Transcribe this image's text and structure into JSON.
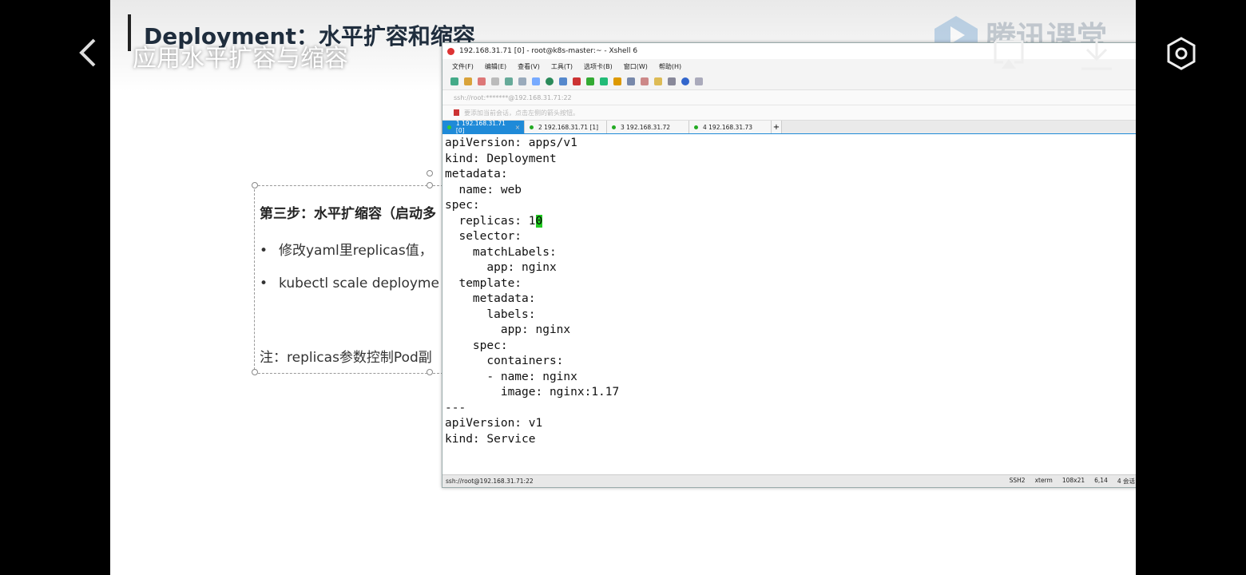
{
  "slide": {
    "title": "Deployment：水平扩容和缩容",
    "watermark": "腾讯课堂",
    "textbox": {
      "heading": "第三步：水平扩缩容（启动多",
      "bullets": [
        "•",
        "修改yaml里replicas值，",
        "kubectl scale deployme"
      ],
      "note": "注：replicas参数控制Pod副"
    }
  },
  "xshell": {
    "window_title": "192.168.31.71 [0] - root@k8s-master:~ - Xshell 6",
    "menu": [
      "文件(F)",
      "编辑(E)",
      "查看(V)",
      "工具(T)",
      "选项卡(B)",
      "窗口(W)",
      "帮助(H)"
    ],
    "address": "ssh://root:*******@192.168.31.71:22",
    "hint": "要添加当前会话，点击左侧的箭头按钮。",
    "tabs": [
      {
        "label": "1 192.168.31.71 [0]",
        "active": true
      },
      {
        "label": "2 192.168.31.71 [1]",
        "active": false
      },
      {
        "label": "3 192.168.31.72",
        "active": false
      },
      {
        "label": "4 192.168.31.73",
        "active": false
      }
    ],
    "tab_add": "+",
    "terminal_lines": [
      "apiVersion: apps/v1",
      "kind: Deployment",
      "metadata:",
      "  name: web",
      "spec:",
      "  replicas: 1",
      "  selector:",
      "    matchLabels:",
      "      app: nginx",
      "  template:",
      "    metadata:",
      "      labels:",
      "        app: nginx",
      "    spec:",
      "      containers:",
      "      - name: nginx",
      "        image: nginx:1.17",
      "---",
      "apiVersion: v1",
      "kind: Service"
    ],
    "cursor_char": "0",
    "status": {
      "connection": "ssh://root@192.168.31.71:22",
      "protocol": "SSH2",
      "term": "xterm",
      "size": "108x21",
      "position": "6,14",
      "sessions": "4 会话"
    }
  },
  "overlay": {
    "lesson_title": "应用水平扩容与缩容",
    "icons": [
      "back-icon",
      "cast-icon",
      "download-icon",
      "settings-icon"
    ]
  }
}
